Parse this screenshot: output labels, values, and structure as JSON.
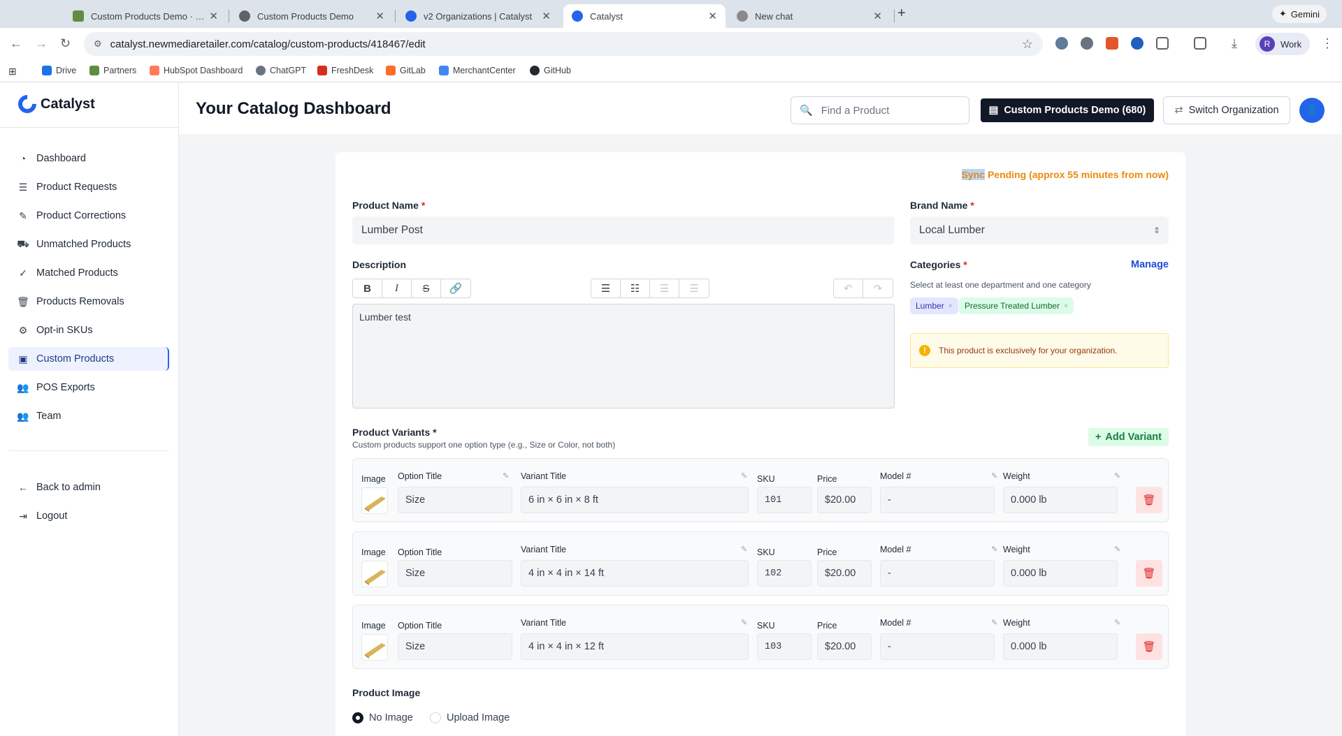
{
  "browser": {
    "tabs": [
      {
        "label": "Custom Products Demo · Me",
        "favicon_color": "#5e8e3e"
      },
      {
        "label": "Custom Products Demo",
        "favicon_color": "#5f6368"
      },
      {
        "label": "v2 Organizations | Catalyst",
        "favicon_color": "#2563eb"
      },
      {
        "label": "Catalyst",
        "favicon_color": "#2563eb"
      },
      {
        "label": "New chat",
        "favicon_color": "#8a8a8a"
      }
    ],
    "tab_close": "✕",
    "new_tab": "+",
    "gemini_label": "Gemini",
    "url": "catalyst.newmediaretailer.com/catalog/custom-products/418467/edit",
    "profile_label": "Work",
    "profile_initial": "R",
    "bookmarks": [
      {
        "label": "Drive",
        "color": "#1a73e8"
      },
      {
        "label": "Partners",
        "color": "#5e8e3e"
      },
      {
        "label": "HubSpot Dashboard",
        "color": "#ff7a59"
      },
      {
        "label": "ChatGPT",
        "color": "#6b7280"
      },
      {
        "label": "FreshDesk",
        "color": "#d62d20"
      },
      {
        "label": "GitLab",
        "color": "#fc6d26"
      },
      {
        "label": "MerchantCenter",
        "color": "#4285f4"
      },
      {
        "label": "GitHub",
        "color": "#24292f"
      }
    ]
  },
  "app": {
    "logo": "Catalyst",
    "page_title": "Your Catalog Dashboard",
    "search_placeholder": "Find a Product",
    "org_button": "Custom Products Demo (680)",
    "switch_button": "Switch Organization",
    "sidebar": {
      "items": [
        {
          "label": "Dashboard",
          "icon": "dashboard-icon",
          "glyph": "◔"
        },
        {
          "label": "Product Requests",
          "icon": "list-icon",
          "glyph": "☰"
        },
        {
          "label": "Product Corrections",
          "icon": "edit-icon",
          "glyph": "✎"
        },
        {
          "label": "Unmatched Products",
          "icon": "cart-icon",
          "glyph": "⛟"
        },
        {
          "label": "Matched Products",
          "icon": "check-circle-icon",
          "glyph": "✓"
        },
        {
          "label": "Products Removals",
          "icon": "trash-icon",
          "glyph": "🗑"
        },
        {
          "label": "Opt-in SKUs",
          "icon": "gear-icon",
          "glyph": "⚙"
        },
        {
          "label": "Custom Products",
          "icon": "box-icon",
          "glyph": "▣"
        },
        {
          "label": "POS Exports",
          "icon": "users-icon",
          "glyph": "👥"
        },
        {
          "label": "Team",
          "icon": "team-icon",
          "glyph": "👥"
        }
      ],
      "back": "Back to admin",
      "logout": "Logout"
    },
    "sync": {
      "highlight_part": "Sync",
      "status_rest": " Pending",
      "eta": "(approx 55 minutes from now)"
    },
    "form": {
      "product_name_label": "Product Name",
      "product_name": "Lumber Post",
      "brand_name_label": "Brand Name",
      "brand_name": "Local Lumber",
      "description_label": "Description",
      "description": "Lumber test",
      "categories_label": "Categories",
      "manage": "Manage",
      "categories_hint": "Select at least one department and one category",
      "chips": [
        {
          "label": "Lumber",
          "bg": "#e0e7ff",
          "fg": "#3730a3"
        },
        {
          "label": "Pressure Treated Lumber",
          "bg": "#dcfce7",
          "fg": "#166534"
        }
      ],
      "notice": "This product is exclusively for your organization.",
      "required_mark": "*"
    },
    "variants": {
      "title": "Product Variants",
      "subtitle": "Custom products support one option type (e.g., Size or Color, not both)",
      "add_label": "Add Variant",
      "headers": {
        "image": "Image",
        "option_title": "Option Title",
        "variant_title": "Variant Title",
        "sku": "SKU",
        "price": "Price",
        "model": "Model #",
        "weight": "Weight"
      },
      "rows": [
        {
          "option": "Size",
          "variant": "6 in × 6 in × 8 ft",
          "sku": "101",
          "price": "$20.00",
          "model": "-",
          "weight": "0.000 lb"
        },
        {
          "option": "Size",
          "variant": "4 in × 4 in × 14 ft",
          "sku": "102",
          "price": "$20.00",
          "model": "-",
          "weight": "0.000 lb"
        },
        {
          "option": "Size",
          "variant": "4 in × 4 in × 12 ft",
          "sku": "103",
          "price": "$20.00",
          "model": "-",
          "weight": "0.000 lb"
        }
      ]
    },
    "product_image": {
      "label": "Product Image",
      "options": [
        "No Image",
        "Upload Image"
      ],
      "selected": "No Image"
    }
  }
}
